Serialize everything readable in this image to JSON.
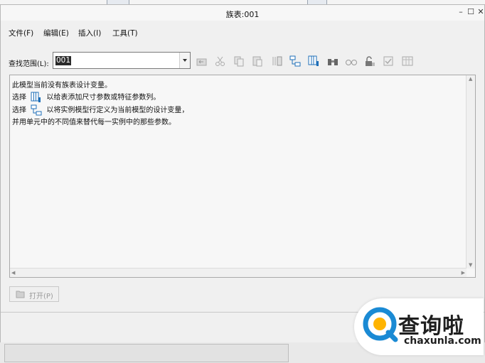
{
  "window": {
    "title": "族表:001",
    "minimize_glyph": "–",
    "maximize_glyph": "☐",
    "close_glyph": "✕"
  },
  "menu": [
    "文件(F)",
    "编辑(E)",
    "插入(I)",
    "工具(T)"
  ],
  "search": {
    "label": "查找范围(L):",
    "value": "001"
  },
  "toolbar_icons": [
    "folder-back-icon",
    "cut-icon",
    "copy-icon",
    "paste-icon",
    "insert-column-icon",
    "add-dimension-icon",
    "add-instance-icon",
    "binoculars-icon",
    "glasses-icon",
    "lock-icon",
    "verify-icon",
    "table-icon"
  ],
  "message": {
    "line1": "此模型当前没有族表设计变量。",
    "line2_prefix": "选择",
    "line2_suffix": "以给表添加尺寸参数或特征参数列。",
    "line3_prefix": "选择",
    "line3_suffix": "以将实例模型行定义为当前模型的设计变量，",
    "line4": "并用单元中的不同值来替代每一实例中的那些参数。"
  },
  "open_button": {
    "label": "打开(P)",
    "icon": "open-folder-icon"
  },
  "watermark": {
    "cn": "查询啦",
    "en": "chaxunla.com",
    "color": "#1a8ad4"
  },
  "colors": {
    "accent": "#1f6fb8",
    "selection": "#2a2a2a"
  }
}
